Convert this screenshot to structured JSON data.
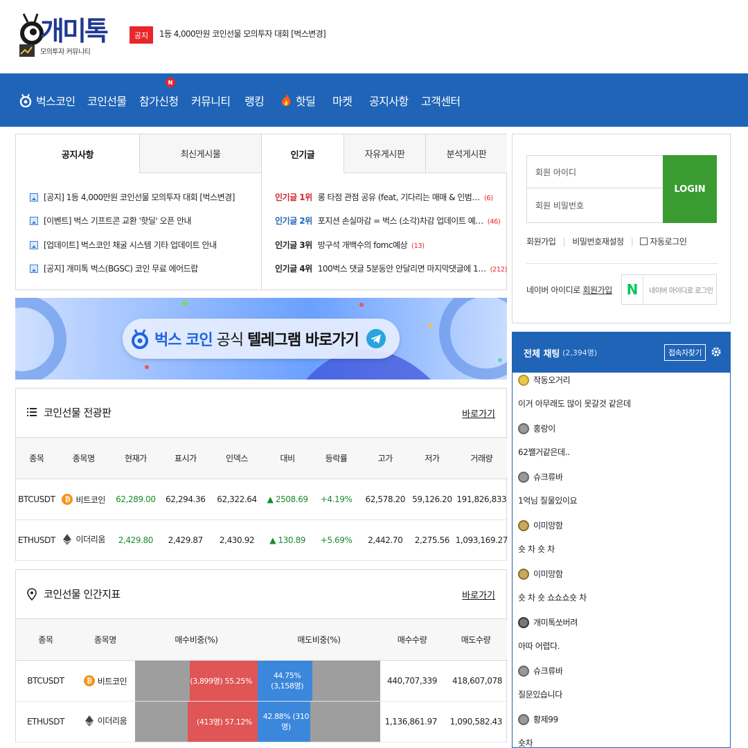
{
  "site": {
    "logo_text": "개미톡",
    "logo_sub": "모의투자 커뮤니티",
    "notice_tag": "공지",
    "notice_text": "1등 4,000만원 코인선물 모의투자 대회 [벅스변경]"
  },
  "nav": {
    "items": [
      "벅스코인",
      "코인선물",
      "참가신청",
      "커뮤니티",
      "랭킹",
      "핫딜",
      "마켓",
      "공지사항",
      "고객센터"
    ],
    "badge": "N"
  },
  "notice_box": {
    "tabs": [
      "공지사항",
      "최신게시물"
    ],
    "rows": [
      {
        "tag": "[공지]",
        "text": "1등 4,000만원 코인선물 모의투자 대회 [벅스변경]"
      },
      {
        "tag": "[이벤트]",
        "text": "벅스 기프트콘 교환 '핫딜' 오픈 안내"
      },
      {
        "tag": "[업데이트]",
        "text": "벅스코인 채굴 시스템 기타 업데이트 안내"
      },
      {
        "tag": "[공지]",
        "text": "개미톡 벅스(BGSC) 코인 무료 에어드랍"
      }
    ]
  },
  "popular_box": {
    "tabs": [
      "인기글",
      "자유게시판",
      "분석게시판"
    ],
    "rows": [
      {
        "rank": "인기글 1위",
        "text": "롱 타점 관점 공유 (feat, 기다리는 매매 & 인범…",
        "count": "(6)",
        "color": "#d0262c"
      },
      {
        "rank": "인기글 2위",
        "text": "포지션 손실마감 = 벅스 (소각)차감 업데이트 예…",
        "count": "(46)",
        "color": "#1f64b7"
      },
      {
        "rank": "인기글 3위",
        "text": "방구석 개백수의 fomc예상",
        "count": "(13)",
        "color": "#222222"
      },
      {
        "rank": "인기글 4위",
        "text": "100벅스 댓글 5분동안 안달리면 마지막댓글에 1…",
        "count": "(212)",
        "color": "#222222"
      }
    ]
  },
  "banner": {
    "brand": "벅스 코인",
    "mid": "공식",
    "cta": "텔레그램 바로가기"
  },
  "futures_board": {
    "title": "코인선물 전광판",
    "more": "바로가기",
    "headers": [
      "종목",
      "종목명",
      "현재가",
      "표시가",
      "인덱스",
      "대비",
      "등락률",
      "고가",
      "저가",
      "거래량"
    ],
    "rows": [
      {
        "symbol": "BTCUSDT",
        "name": "비트코인",
        "current": "62,289.00",
        "mark": "62,294.36",
        "index": "62,322.64",
        "change": "▲ 2508.69",
        "rate": "+4.19%",
        "high": "62,578.20",
        "low": "59,126.20",
        "volume": "191,826,833"
      },
      {
        "symbol": "ETHUSDT",
        "name": "이더리움",
        "current": "2,429.80",
        "mark": "2,429.87",
        "index": "2,430.92",
        "change": "▲ 130.89",
        "rate": "+5.69%",
        "high": "2,442.70",
        "low": "2,275.56",
        "volume": "1,093,169.27"
      }
    ]
  },
  "sentiment_board": {
    "title": "코인선물 인간지표",
    "more": "바로가기",
    "headers": [
      "종목",
      "종목명",
      "매수비중(%)",
      "매도비중(%)",
      "매수수량",
      "매도수량"
    ],
    "rows": [
      {
        "symbol": "BTCUSDT",
        "name": "비트코인",
        "buy_label": "(3,899명) 55.25%",
        "buy_pct": 55.25,
        "sell_label": "44.75% (3,158명)",
        "sell_pct": 44.75,
        "buy_qty": "440,707,339",
        "sell_qty": "418,607,078"
      },
      {
        "symbol": "ETHUSDT",
        "name": "이더리움",
        "buy_label": "(413명) 57.12%",
        "buy_pct": 57.12,
        "sell_label": "42.88% (310명)",
        "sell_pct": 42.88,
        "buy_qty": "1,136,861.97",
        "sell_qty": "1,090,582.43"
      }
    ]
  },
  "login": {
    "id_placeholder": "회원 아이디",
    "pw_placeholder": "회원 비밀번호",
    "button": "LOGIN",
    "signup": "회원가입",
    "reset": "비밀번호재설정",
    "auto": "자동로그인",
    "naver_text_prefix": "네이버 아이디로",
    "naver_signup": "회원가입",
    "naver_login": "네이버 아이디로 로그인"
  },
  "chat": {
    "title": "전체 채팅",
    "count": "(2,394명)",
    "find_button": "접속자찾기",
    "messages": [
      {
        "nick": "작동오거리",
        "msg": "이거 아무래도 많이 못갈것 같은데",
        "level": "g"
      },
      {
        "nick": "홍랑이",
        "msg": "62쨀거같은데..",
        "level": "n"
      },
      {
        "nick": "슈크류바",
        "msg": "1억님 질물있이요",
        "level": "n"
      },
      {
        "nick": "이미망함",
        "msg": "숏 차 숏 차",
        "level": "s"
      },
      {
        "nick": "이미망함",
        "msg": "숏 차 숏 쇼쇼쇼숏 차",
        "level": "s"
      },
      {
        "nick": "개미톡쏘버려",
        "msg": "아따 어렵다.",
        "level": "d"
      },
      {
        "nick": "슈크류바",
        "msg": "질문있습니다",
        "level": "n"
      },
      {
        "nick": "황제99",
        "msg": "숏차",
        "level": "n"
      }
    ]
  }
}
